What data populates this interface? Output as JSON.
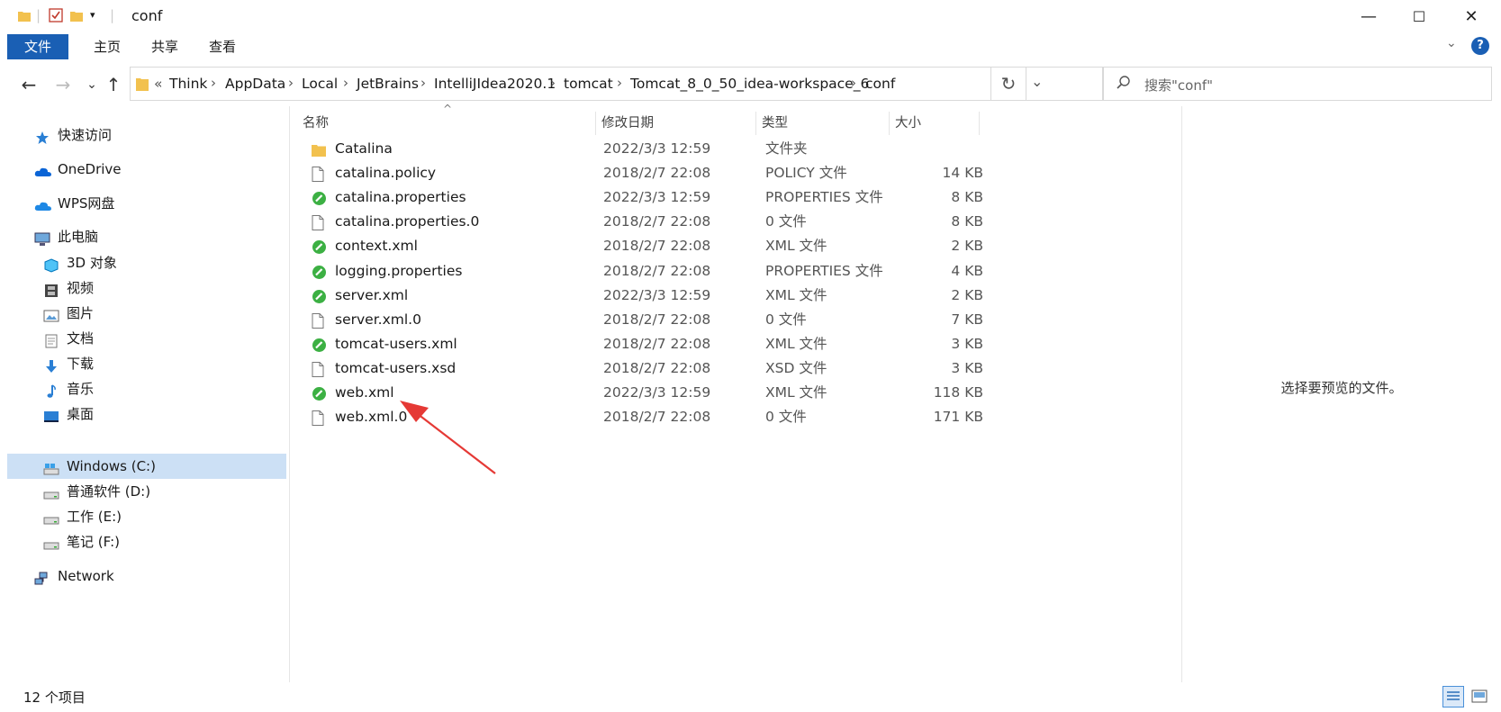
{
  "window": {
    "title": "conf",
    "minimize_glyph": "—",
    "maximize_glyph": "☐",
    "close_glyph": "✕"
  },
  "ribbon": {
    "tabs": [
      {
        "label": "文件",
        "active": true
      },
      {
        "label": "主页"
      },
      {
        "label": "共享"
      },
      {
        "label": "查看"
      }
    ],
    "help_glyph": "?"
  },
  "nav": {
    "back_glyph": "←",
    "forward_glyph": "→",
    "recent_glyph": "⌄",
    "up_glyph": "↑"
  },
  "address": {
    "overflow": "«",
    "crumbs": [
      "Think",
      "AppData",
      "Local",
      "JetBrains",
      "IntelliJIdea2020.1",
      "tomcat",
      "Tomcat_8_0_50_idea-workspace_6",
      "conf"
    ],
    "separator": "›",
    "dropdown_glyph": "⌄",
    "refresh_glyph": "↻"
  },
  "search": {
    "placeholder": "搜索\"conf\""
  },
  "sidebar": {
    "items": [
      {
        "label": "快速访问",
        "icon": "star-icon"
      },
      {
        "label": "OneDrive",
        "icon": "cloud-icon"
      },
      {
        "label": "WPS网盘",
        "icon": "cloud-icon"
      },
      {
        "label": "此电脑",
        "icon": "computer-icon"
      },
      {
        "label": "3D 对象",
        "icon": "cube-icon"
      },
      {
        "label": "视频",
        "icon": "film-icon"
      },
      {
        "label": "图片",
        "icon": "picture-icon"
      },
      {
        "label": "文档",
        "icon": "document-icon"
      },
      {
        "label": "下载",
        "icon": "download-icon"
      },
      {
        "label": "音乐",
        "icon": "music-icon"
      },
      {
        "label": "桌面",
        "icon": "desktop-icon"
      },
      {
        "label": "Windows (C:)",
        "icon": "drive-icon",
        "selected": true
      },
      {
        "label": "普通软件 (D:)",
        "icon": "drive-icon"
      },
      {
        "label": "工作 (E:)",
        "icon": "drive-icon"
      },
      {
        "label": "笔记 (F:)",
        "icon": "drive-icon"
      },
      {
        "label": "Network",
        "icon": "network-icon"
      }
    ]
  },
  "columns": {
    "name": "名称",
    "date": "修改日期",
    "type": "类型",
    "size": "大小"
  },
  "files": [
    {
      "name": "Catalina",
      "date": "2022/3/3 12:59",
      "type": "文件夹",
      "size": "",
      "icon": "folder-icon"
    },
    {
      "name": "catalina.policy",
      "date": "2018/2/7 22:08",
      "type": "POLICY 文件",
      "size": "14 KB",
      "icon": "file-icon"
    },
    {
      "name": "catalina.properties",
      "date": "2022/3/3 12:59",
      "type": "PROPERTIES 文件",
      "size": "8 KB",
      "icon": "green-file-icon"
    },
    {
      "name": "catalina.properties.0",
      "date": "2018/2/7 22:08",
      "type": "0 文件",
      "size": "8 KB",
      "icon": "file-icon"
    },
    {
      "name": "context.xml",
      "date": "2018/2/7 22:08",
      "type": "XML 文件",
      "size": "2 KB",
      "icon": "green-file-icon"
    },
    {
      "name": "logging.properties",
      "date": "2018/2/7 22:08",
      "type": "PROPERTIES 文件",
      "size": "4 KB",
      "icon": "green-file-icon"
    },
    {
      "name": "server.xml",
      "date": "2022/3/3 12:59",
      "type": "XML 文件",
      "size": "2 KB",
      "icon": "green-file-icon"
    },
    {
      "name": "server.xml.0",
      "date": "2018/2/7 22:08",
      "type": "0 文件",
      "size": "7 KB",
      "icon": "file-icon"
    },
    {
      "name": "tomcat-users.xml",
      "date": "2018/2/7 22:08",
      "type": "XML 文件",
      "size": "3 KB",
      "icon": "green-file-icon"
    },
    {
      "name": "tomcat-users.xsd",
      "date": "2018/2/7 22:08",
      "type": "XSD 文件",
      "size": "3 KB",
      "icon": "file-icon"
    },
    {
      "name": "web.xml",
      "date": "2022/3/3 12:59",
      "type": "XML 文件",
      "size": "118 KB",
      "icon": "green-file-icon"
    },
    {
      "name": "web.xml.0",
      "date": "2018/2/7 22:08",
      "type": "0 文件",
      "size": "171 KB",
      "icon": "file-icon"
    }
  ],
  "preview": {
    "message": "选择要预览的文件。"
  },
  "status": {
    "count": "12 个项目"
  },
  "colors": {
    "accent": "#1a5fb4",
    "selection": "#cce0f5",
    "annotation_arrow": "#e53935",
    "folder": "#f2c14e",
    "green_badge": "#3cb043"
  }
}
